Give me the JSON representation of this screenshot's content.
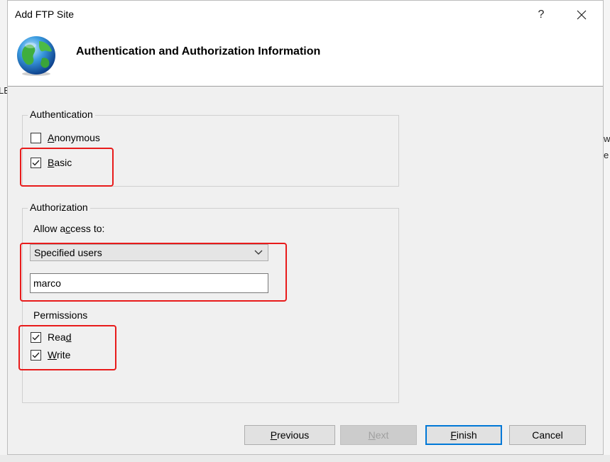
{
  "background": {
    "left_fragment": "LE",
    "right_fragments": [
      "w",
      "e"
    ]
  },
  "dialog": {
    "title": "Add FTP Site",
    "help_label": "?",
    "close_label": "✕",
    "header_title": "Authentication and Authorization Information"
  },
  "authentication": {
    "legend": "Authentication",
    "anonymous": {
      "label_key": "A",
      "label_rest": "nonymous",
      "checked": false
    },
    "basic": {
      "label_key": "B",
      "label_rest": "asic",
      "checked": true
    }
  },
  "authorization": {
    "legend": "Authorization",
    "allow_label_pre": "Allow a",
    "allow_label_key": "c",
    "allow_label_post": "cess to:",
    "allow_select_value": "Specified users",
    "users_value": "marco",
    "permissions_label": "Permissions",
    "read": {
      "label_pre": "Rea",
      "label_key": "d",
      "checked": true
    },
    "write": {
      "label_key": "W",
      "label_rest": "rite",
      "checked": true
    }
  },
  "buttons": {
    "previous_key": "P",
    "previous_rest": "revious",
    "next_key": "N",
    "next_rest": "ext",
    "finish_key": "F",
    "finish_rest": "inish",
    "cancel": "Cancel"
  },
  "colors": {
    "annotation": "#e81b1b",
    "accent": "#0078d7"
  }
}
